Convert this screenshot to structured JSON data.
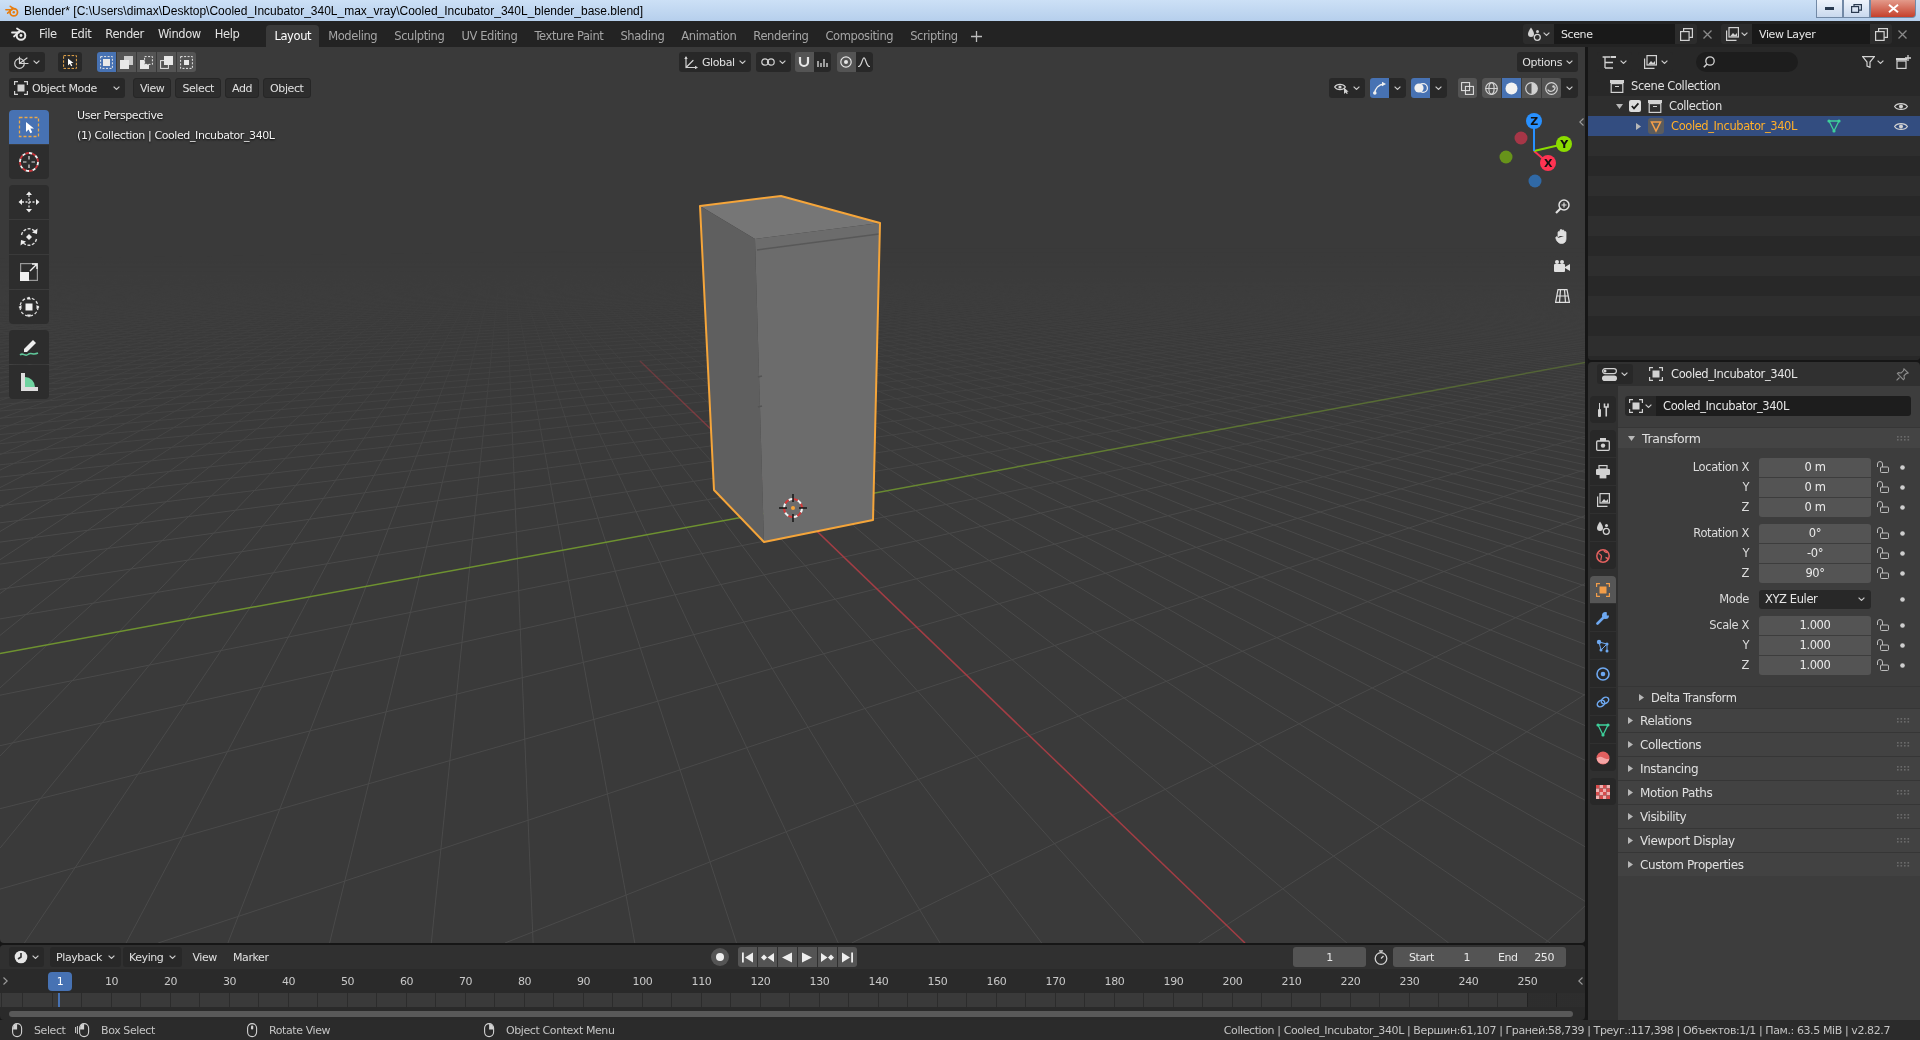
{
  "window": {
    "title": "Blender* [C:\\Users\\dimax\\Desktop\\Cooled_Incubator_340L_max_vray\\Cooled_Incubator_340L_blender_base.blend]"
  },
  "topbar": {
    "menu": [
      "File",
      "Edit",
      "Render",
      "Window",
      "Help"
    ],
    "workspaces": [
      {
        "label": "Layout",
        "selected": true
      },
      {
        "label": "Modeling",
        "selected": false
      },
      {
        "label": "Sculpting",
        "selected": false
      },
      {
        "label": "UV Editing",
        "selected": false
      },
      {
        "label": "Texture Paint",
        "selected": false
      },
      {
        "label": "Shading",
        "selected": false
      },
      {
        "label": "Animation",
        "selected": false
      },
      {
        "label": "Rendering",
        "selected": false
      },
      {
        "label": "Compositing",
        "selected": false
      },
      {
        "label": "Scripting",
        "selected": false
      }
    ],
    "scene": "Scene",
    "view_layer": "View Layer"
  },
  "viewport": {
    "tool_header": {
      "select_modes": [
        {
          "selected": true
        },
        {
          "selected": false
        },
        {
          "selected": false
        },
        {
          "selected": false
        },
        {
          "selected": false
        }
      ],
      "orientation": "Global",
      "snap": false,
      "proportional": false,
      "options": "Options"
    },
    "header": {
      "mode": "Object Mode",
      "menus": [
        "View",
        "Select",
        "Add",
        "Object"
      ],
      "gizmos": true,
      "overlays": true,
      "xray": false,
      "shading": [
        {
          "selected": false
        },
        {
          "selected": true
        },
        {
          "selected": false
        },
        {
          "selected": false
        }
      ]
    },
    "toolbar": [
      {
        "tools": [
          {
            "selected": true
          },
          {
            "selected": false
          }
        ]
      },
      {
        "tools": [
          {
            "selected": false
          },
          {
            "selected": false
          },
          {
            "selected": false
          },
          {
            "selected": false
          }
        ]
      },
      {
        "tools": [
          {
            "selected": false
          },
          {
            "selected": false
          }
        ]
      }
    ],
    "overlay_text": [
      "User Perspective",
      "(1) Collection | Cooled_Incubator_340L"
    ],
    "gizmo": {
      "axes": [
        {
          "label": "X",
          "color": "#ff3352"
        },
        {
          "label": "Y",
          "color": "#8bdc00"
        },
        {
          "label": "Z",
          "color": "#2890ff"
        }
      ]
    }
  },
  "outliner": {
    "tree": [
      {
        "label": "Scene Collection",
        "kind": "scene_collection",
        "selected": false,
        "children": [
          {
            "label": "Collection",
            "kind": "collection",
            "selected": false,
            "expanded": true,
            "checked": true,
            "visible": true,
            "children": [
              {
                "label": "Cooled_Incubator_340L",
                "kind": "object",
                "selected": true,
                "expanded": false,
                "visible": true
              }
            ]
          }
        ]
      }
    ]
  },
  "properties": {
    "header_title": "Cooled_Incubator_340L",
    "tab_groups": [
      {
        "tabs": [
          {
            "selected": false
          }
        ]
      },
      {
        "tabs": [
          {
            "selected": false
          },
          {
            "selected": false
          },
          {
            "selected": false
          },
          {
            "selected": false
          },
          {
            "selected": false
          }
        ]
      },
      {
        "tabs": [
          {
            "selected": true
          },
          {
            "selected": false
          },
          {
            "selected": false
          },
          {
            "selected": false
          },
          {
            "selected": false
          },
          {
            "selected": false
          },
          {
            "selected": false
          }
        ]
      },
      {
        "tabs": [
          {
            "selected": false
          }
        ]
      }
    ],
    "object_name": "Cooled_Incubator_340L",
    "transform": {
      "title": "Transform",
      "expanded": true,
      "groups": [
        {
          "rows": [
            {
              "label": "Location X",
              "value": "0 m",
              "kind": "number",
              "locked": false
            },
            {
              "label": "Y",
              "value": "0 m",
              "kind": "number",
              "locked": false
            },
            {
              "label": "Z",
              "value": "0 m",
              "kind": "number",
              "locked": false
            }
          ]
        },
        {
          "rows": [
            {
              "label": "Rotation X",
              "value": "0°",
              "kind": "number",
              "locked": false
            },
            {
              "label": "Y",
              "value": "-0°",
              "kind": "number",
              "locked": false
            },
            {
              "label": "Z",
              "value": "90°",
              "kind": "number",
              "locked": false
            }
          ]
        },
        {
          "rows": [
            {
              "label": "Mode",
              "value": "XYZ Euler",
              "kind": "dropdown"
            }
          ]
        },
        {
          "rows": [
            {
              "label": "Scale X",
              "value": "1.000",
              "kind": "number",
              "locked": false
            },
            {
              "label": "Y",
              "value": "1.000",
              "kind": "number",
              "locked": false
            },
            {
              "label": "Z",
              "value": "1.000",
              "kind": "number",
              "locked": false
            }
          ]
        }
      ],
      "subpanels": [
        {
          "title": "Delta Transform",
          "expanded": false
        }
      ]
    },
    "panels": [
      {
        "title": "Relations",
        "expanded": false
      },
      {
        "title": "Collections",
        "expanded": false
      },
      {
        "title": "Instancing",
        "expanded": false
      },
      {
        "title": "Motion Paths",
        "expanded": false
      },
      {
        "title": "Visibility",
        "expanded": false
      },
      {
        "title": "Viewport Display",
        "expanded": false
      },
      {
        "title": "Custom Properties",
        "expanded": false
      }
    ]
  },
  "timeline": {
    "menus": [
      {
        "label": "Playback",
        "kind": "dropdown"
      },
      {
        "label": "Keying",
        "kind": "dropdown"
      },
      {
        "label": "View",
        "kind": "menu"
      },
      {
        "label": "Marker",
        "kind": "menu"
      }
    ],
    "current_frame": "1",
    "start": {
      "label": "Start",
      "value": "1"
    },
    "end": {
      "label": "End",
      "value": "250"
    },
    "playhead_label": "1",
    "ruler": [
      "10",
      "20",
      "30",
      "40",
      "50",
      "60",
      "70",
      "80",
      "90",
      "100",
      "110",
      "120",
      "130",
      "140",
      "150",
      "160",
      "170",
      "180",
      "190",
      "200",
      "210",
      "220",
      "230",
      "240",
      "250"
    ]
  },
  "status_bar": {
    "hints": [
      "Select",
      "Box Select",
      "Rotate View",
      "Object Context Menu"
    ],
    "stats": "Collection | Cooled_Incubator_340L | Вершин:61,107 | Граней:58,739 | Треуг.:117,398 | Объектов:1/1 | Пам.: 63.5 MiB | v2.82.7"
  }
}
